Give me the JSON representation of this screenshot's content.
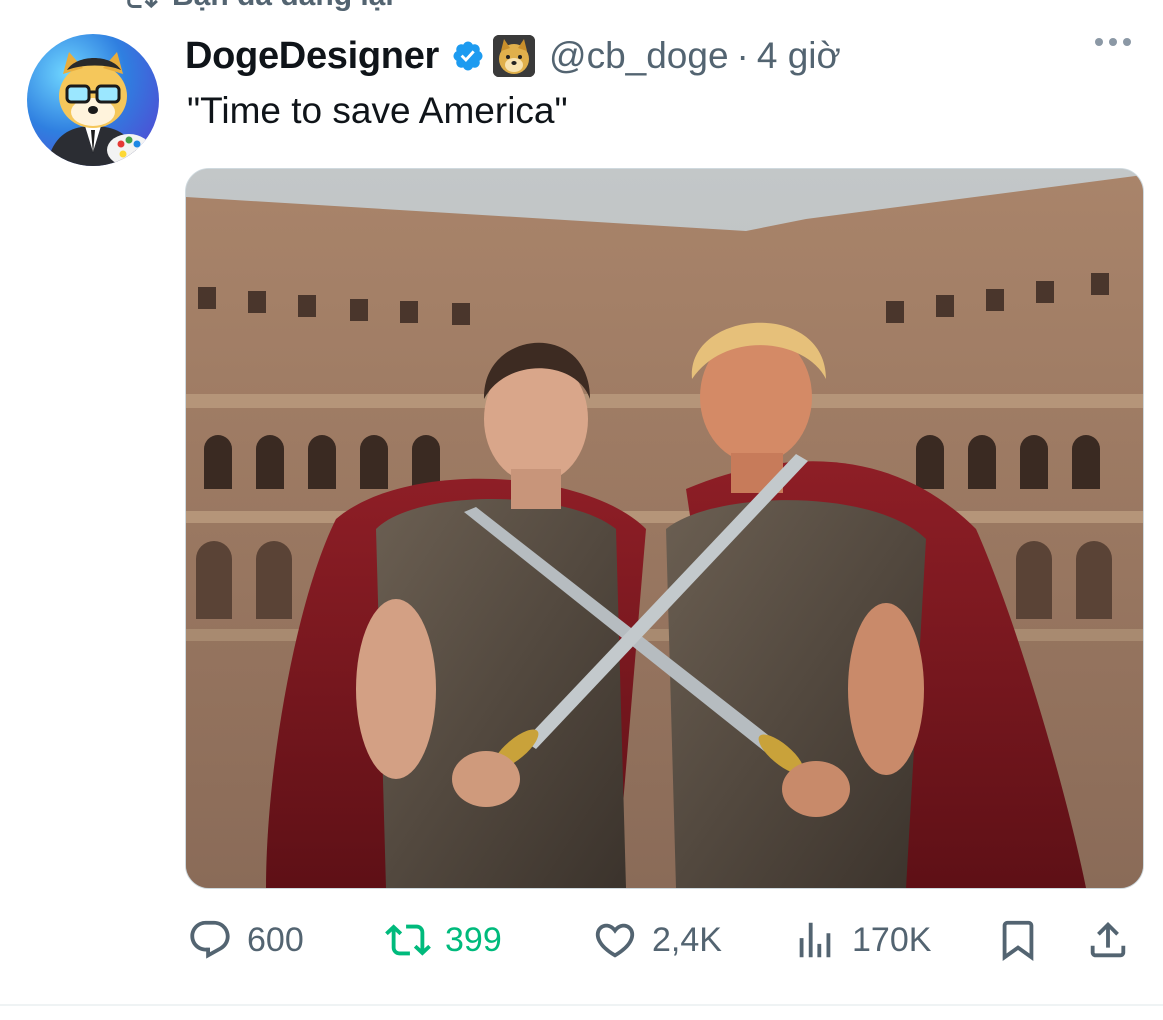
{
  "repost": {
    "label": "Bạn đã đăng lại"
  },
  "tweet": {
    "display_name": "DogeDesigner",
    "handle": "@cb_doge",
    "separator": "·",
    "time": "4 giờ",
    "text": "\"Time to save America\""
  },
  "actions": {
    "replies": "600",
    "reposts": "399",
    "likes": "2,4K",
    "views": "170K"
  },
  "icons": {
    "repost": "repost-icon",
    "verified": "verified-badge-icon",
    "reply": "reply-icon",
    "retweet": "retweet-icon",
    "like": "heart-icon",
    "views": "views-chart-icon",
    "bookmark": "bookmark-icon",
    "share": "share-icon",
    "more": "more-dots-icon"
  },
  "colors": {
    "text": "#0f1419",
    "muted": "#536471",
    "verified": "#1d9bf0",
    "retweeted": "#00ba7c"
  }
}
